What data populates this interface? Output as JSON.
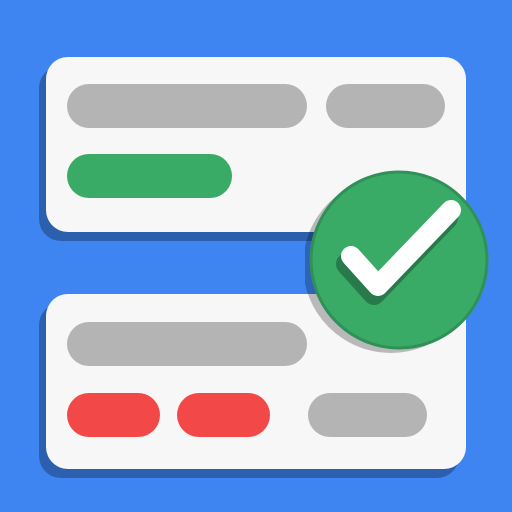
{
  "colors": {
    "background": "#3e85f2",
    "card": "#f7f7f7",
    "placeholder_gray": "#b4b4b4",
    "valid_green": "#3aaa67",
    "error_red": "#f24848",
    "badge": "#3aaa67",
    "checkmark": "#ffffff"
  },
  "icons": {
    "badge": "check-circle-icon",
    "checkmark": "checkmark-icon"
  },
  "cards": [
    {
      "name": "top-card",
      "rows": [
        [
          "gray",
          "gray"
        ],
        [
          "green"
        ]
      ]
    },
    {
      "name": "bottom-card",
      "rows": [
        [
          "gray"
        ],
        [
          "red",
          "red",
          "gray"
        ]
      ]
    }
  ]
}
